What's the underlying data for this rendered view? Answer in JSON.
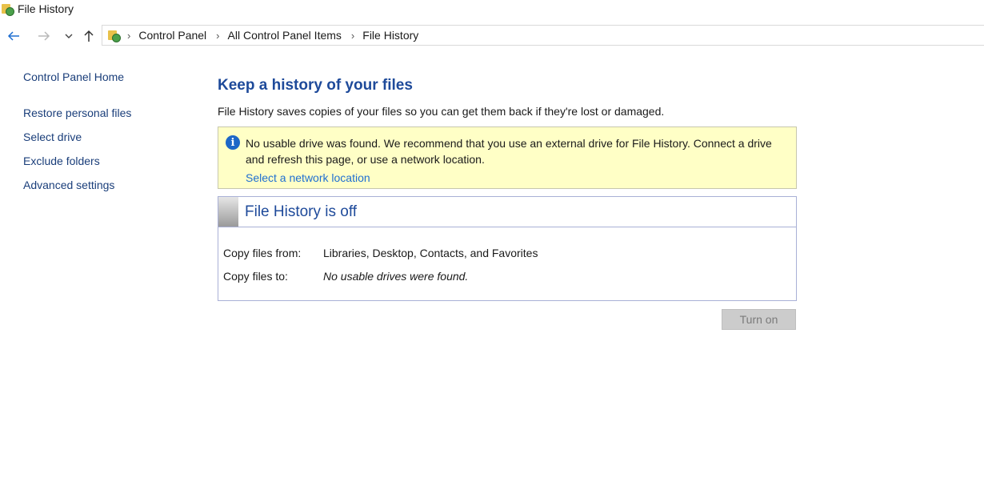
{
  "window": {
    "title": "File History",
    "icon": "file-history-icon"
  },
  "nav": {
    "back_icon": "back-arrow-icon",
    "forward_icon": "forward-arrow-icon",
    "recent_icon": "chevron-down-icon",
    "up_icon": "up-arrow-icon"
  },
  "breadcrumb": {
    "items": [
      "Control Panel",
      "All Control Panel Items",
      "File History"
    ],
    "separator": "›"
  },
  "sidebar": {
    "home": "Control Panel Home",
    "items": [
      {
        "label": "Restore personal files"
      },
      {
        "label": "Select drive"
      },
      {
        "label": "Exclude folders"
      },
      {
        "label": "Advanced settings"
      }
    ]
  },
  "main": {
    "title": "Keep a history of your files",
    "description": "File History saves copies of your files so you can get them back if they're lost or damaged.",
    "notice": {
      "icon": "info-icon",
      "text": "No usable drive was found. We recommend that you use an external drive for File History. Connect a drive and refresh this page, or use a network location.",
      "link": "Select a network location"
    },
    "status": {
      "title": "File History is off",
      "copy_from_label": "Copy files from:",
      "copy_from_value": "Libraries, Desktop, Contacts, and Favorites",
      "copy_to_label": "Copy files to:",
      "copy_to_value": "No usable drives were found."
    },
    "turn_on_label": "Turn on"
  },
  "colors": {
    "link": "#1f6fd1",
    "heading": "#1e4a9a",
    "notice_bg": "#ffffc6",
    "panel_border": "#a9b0d6"
  }
}
